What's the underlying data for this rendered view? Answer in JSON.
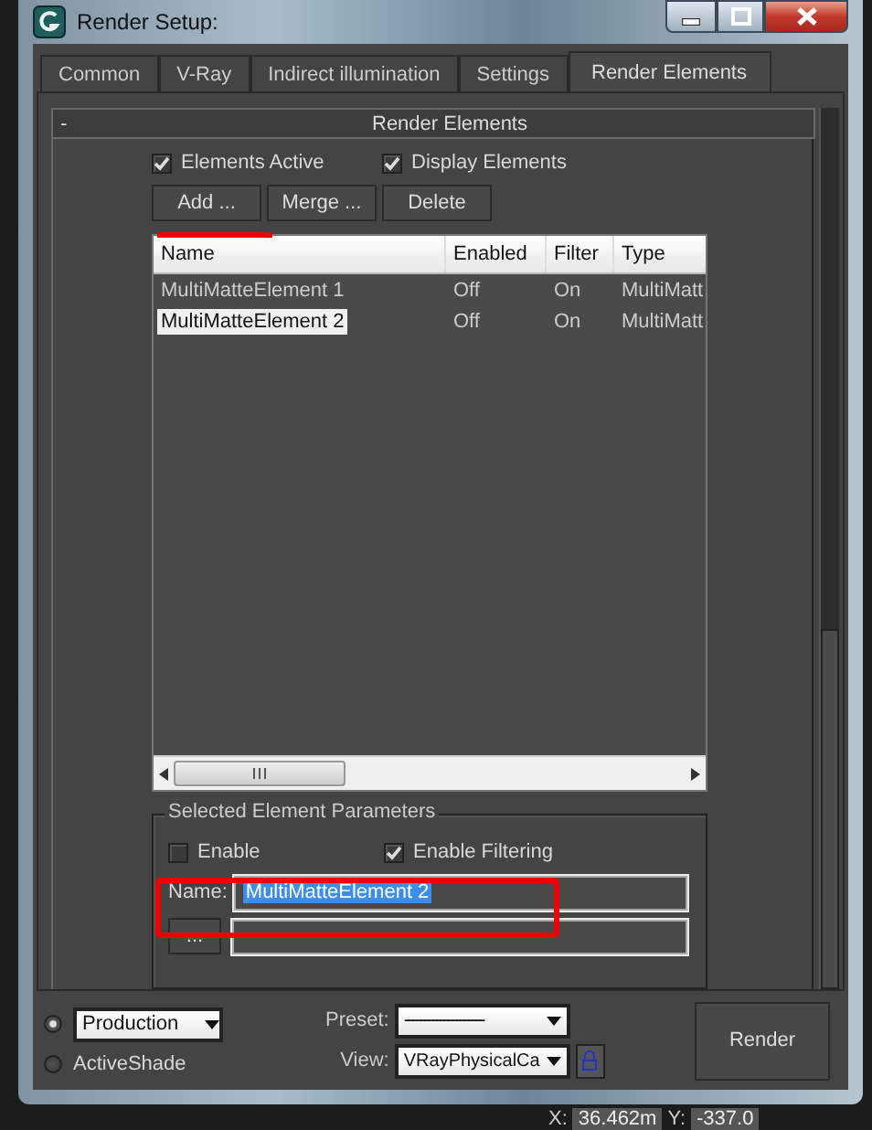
{
  "window": {
    "title": "Render Setup:"
  },
  "tabs": [
    {
      "label": "Common",
      "selected": false
    },
    {
      "label": "V-Ray",
      "selected": false
    },
    {
      "label": "Indirect illumination",
      "selected": false
    },
    {
      "label": "Settings",
      "selected": false
    },
    {
      "label": "Render Elements",
      "selected": true
    }
  ],
  "rollout": {
    "toggle": "-",
    "title": "Render Elements"
  },
  "options": [
    {
      "label": "Elements Active",
      "checked": true
    },
    {
      "label": "Display Elements",
      "checked": true
    }
  ],
  "buttons": [
    "Add ...",
    "Merge ...",
    "Delete"
  ],
  "table": {
    "columns": [
      "Name",
      "Enabled",
      "Filter",
      "Type"
    ],
    "rows": [
      {
        "cells": [
          "MultiMatteElement 1",
          "Off",
          "On",
          "MultiMatt"
        ],
        "selected": false
      },
      {
        "cells": [
          "MultiMatteElement 2",
          "Off",
          "On",
          "MultiMatt"
        ],
        "selected": true
      }
    ]
  },
  "parameters": {
    "title": "Selected Element Parameters",
    "options": [
      {
        "label": "Enable",
        "checked": false
      },
      {
        "label": "Enable Filtering",
        "checked": true
      }
    ],
    "name_label": "Name:",
    "name_value": "MultiMatteElement 2",
    "browse_button": "..."
  },
  "bottom": {
    "modes": [
      {
        "label": "Production",
        "kind": "dropdown",
        "selected": true
      },
      {
        "label": "ActiveShade",
        "kind": "label",
        "selected": false
      }
    ],
    "preset_label": "Preset:",
    "preset_value": "--------------------",
    "view_label": "View:",
    "view_value": "VRayPhysicalCa",
    "render_button": "Render"
  },
  "status_bar": {
    "x_label": "X:",
    "x_value": "36.462m",
    "y_label": "Y:",
    "y_value": "-337.0"
  }
}
